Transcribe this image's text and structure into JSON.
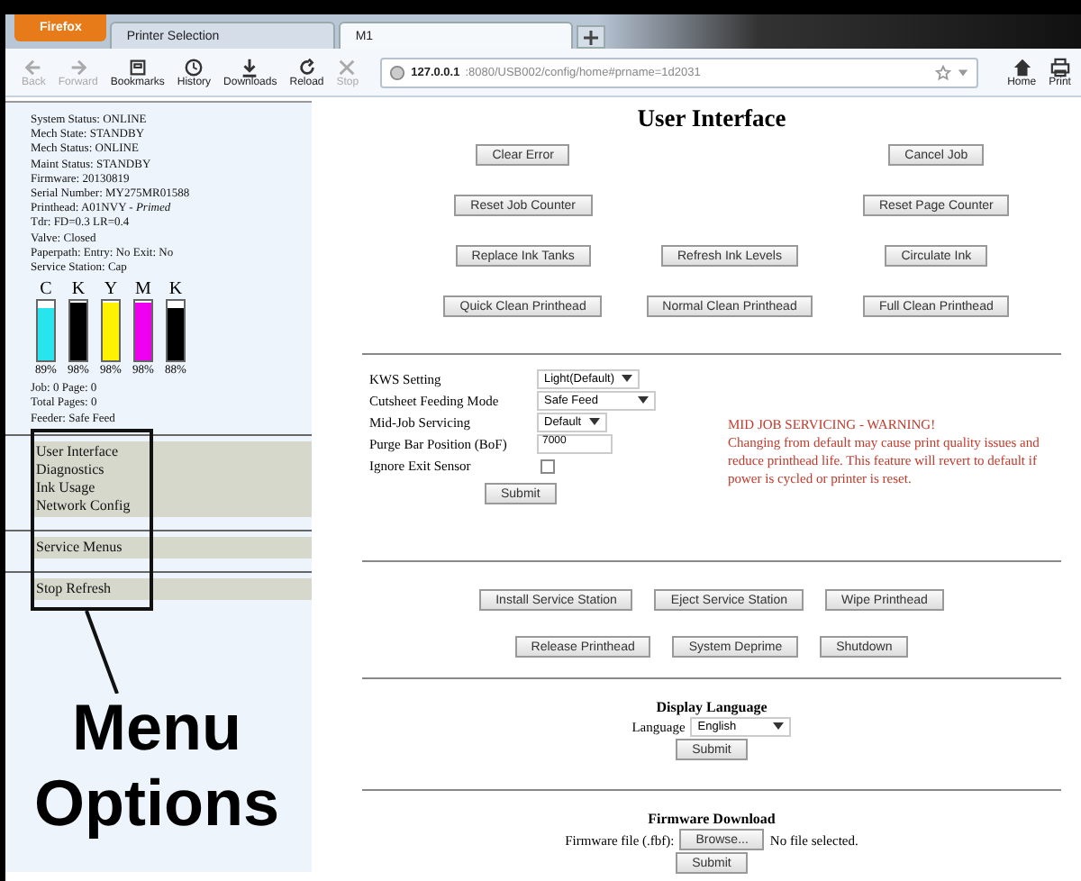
{
  "browser": {
    "app_menu": "Firefox",
    "tabs": [
      {
        "label": "Printer Selection",
        "selected": false
      },
      {
        "label": "M1",
        "selected": true
      }
    ],
    "toolbar": [
      {
        "label": "Back",
        "disabled": true
      },
      {
        "label": "Forward",
        "disabled": true
      },
      {
        "label": "Bookmarks",
        "disabled": false
      },
      {
        "label": "History",
        "disabled": false
      },
      {
        "label": "Downloads",
        "disabled": false
      },
      {
        "label": "Reload",
        "disabled": false
      },
      {
        "label": "Stop",
        "disabled": true
      }
    ],
    "address": {
      "host": "127.0.0.1",
      "path": ":8080/USB002/config/home#prname=1d2031"
    },
    "right_buttons": [
      "Home",
      "Print"
    ]
  },
  "sidebar": {
    "status_lines": [
      "System Status: ONLINE",
      "Mech State: STANDBY",
      "Mech Status: ONLINE",
      "Maint Status: STANDBY",
      "Firmware: 20130819",
      "Serial Number: MY275MR01588",
      "Printhead: A01NVY - *Primed*",
      "Tdr: FD=0.3 LR=0.4",
      "Valve: Closed",
      "Paperpath: Entry: No Exit: No",
      "Service Station: Cap"
    ],
    "ink_tanks": [
      {
        "letter": "C",
        "color": "#28e4ec",
        "level": 0.89,
        "reading": "89%"
      },
      {
        "letter": "K",
        "color": "#000000",
        "level": 0.98,
        "reading": "98%"
      },
      {
        "letter": "Y",
        "color": "#fff200",
        "level": 0.98,
        "reading": "98%"
      },
      {
        "letter": "M",
        "color": "#ee00ee",
        "level": 0.98,
        "reading": "98%"
      },
      {
        "letter": "K",
        "color": "#000000",
        "level": 0.88,
        "reading": "88%"
      }
    ],
    "counters": [
      "Job: 0 Page: 0",
      "Total Pages: 0",
      "Feeder: Safe Feed"
    ],
    "menu_groups": [
      [
        "User Interface",
        "Diagnostics",
        "Ink Usage",
        "Network Config"
      ],
      [
        "Service Menus"
      ],
      [
        "Stop Refresh"
      ]
    ]
  },
  "annotation": {
    "lines": [
      "Menu",
      "Options"
    ]
  },
  "main": {
    "title": "User Interface",
    "button_rows": [
      {
        "left": "Clear Error",
        "right": "Cancel Job"
      },
      {
        "left": "Reset Job Counter",
        "right": "Reset Page Counter"
      },
      {
        "left": "Replace Ink Tanks",
        "center": "Refresh Ink Levels",
        "right": "Circulate Ink"
      },
      {
        "left": "Quick Clean Printhead",
        "center": "Normal Clean Printhead",
        "right": "Full Clean Printhead"
      }
    ],
    "settings": [
      {
        "kind": "select",
        "label": "KWS Setting",
        "value": "Light(Default)"
      },
      {
        "kind": "select",
        "label": "Cutsheet Feeding Mode",
        "value": "Safe Feed"
      },
      {
        "kind": "select",
        "label": "Mid-Job Servicing",
        "value": "Default"
      },
      {
        "kind": "text",
        "label": "Purge Bar Position (BoF)",
        "value": "7000"
      },
      {
        "kind": "checkbox",
        "label": "Ignore Exit Sensor",
        "checked": false
      }
    ],
    "settings_submit": "Submit",
    "warning": {
      "title": "MID JOB SERVICING - WARNING!",
      "text": "Changing from default may cause print quality issues and reduce printhead life. This feature will revert to default if power is cycled or printer is reset."
    },
    "service_rows": [
      [
        "Install Service Station",
        "Eject Service Station",
        "Wipe Printhead"
      ],
      [
        "Release Printhead",
        "System Deprime",
        "Shutdown"
      ]
    ],
    "language": {
      "heading": "Display Language",
      "label": "Language",
      "value": "English",
      "submit": "Submit"
    },
    "firmware": {
      "heading": "Firmware Download",
      "label": "Firmware file (.fbf):",
      "browse": "Browse...",
      "file_status": "No file selected.",
      "submit": "Submit"
    }
  }
}
